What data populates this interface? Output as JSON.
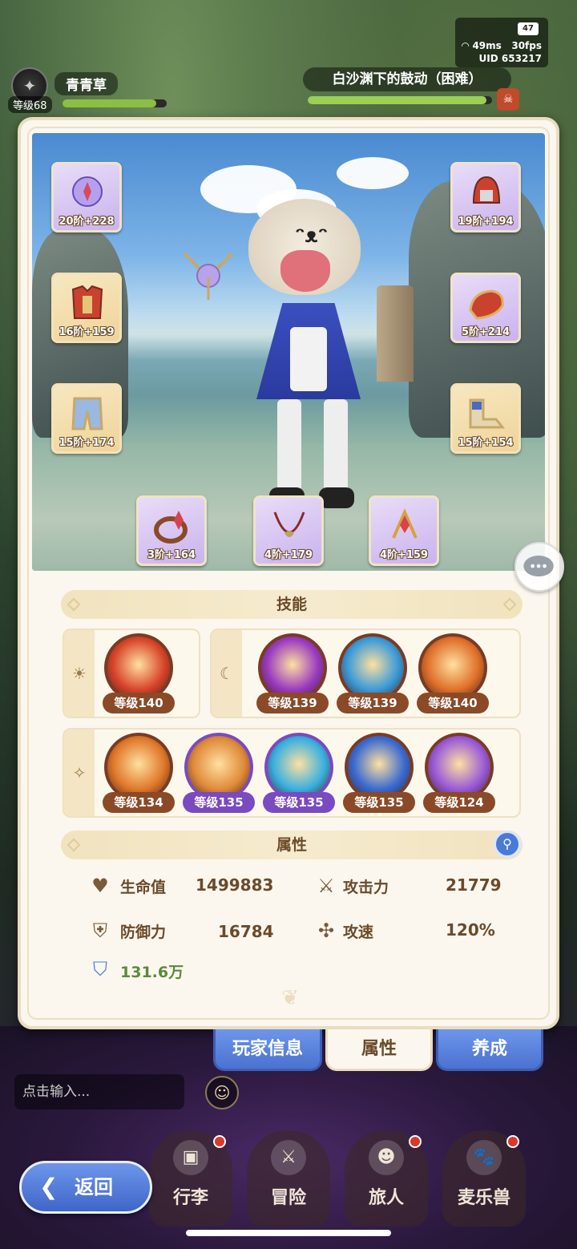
{
  "status": {
    "battery": "47",
    "ping": "49ms",
    "fps": "30fps",
    "uid": "UID 653217"
  },
  "player": {
    "name": "青青草",
    "level": "等级68",
    "exp_progress": 0.9
  },
  "quest": {
    "title": "白沙渊下的鼓动（困难）",
    "progress": 0.97
  },
  "equipment": [
    {
      "name": "staff-item",
      "label": "20阶+228",
      "rarity": "purple"
    },
    {
      "name": "armor-item",
      "label": "16阶+159",
      "rarity": "gold"
    },
    {
      "name": "pants-item",
      "label": "15阶+174",
      "rarity": "gold"
    },
    {
      "name": "helmet-item",
      "label": "19阶+194",
      "rarity": "purple"
    },
    {
      "name": "gloves-item",
      "label": "5阶+214",
      "rarity": "purple"
    },
    {
      "name": "boots-item",
      "label": "15阶+154",
      "rarity": "gold"
    },
    {
      "name": "bracelet-item",
      "label": "3阶+164",
      "rarity": "purple"
    },
    {
      "name": "necklace-item",
      "label": "4阶+179",
      "rarity": "purple"
    },
    {
      "name": "charm-item",
      "label": "4阶+159",
      "rarity": "purple"
    }
  ],
  "skills_section": {
    "title": "技能",
    "sun_group": [
      {
        "icon": "burst-star-icon",
        "level": "等级140",
        "color": "#d8442a",
        "purple": false
      }
    ],
    "moon_group": [
      {
        "icon": "crosshair-icon",
        "level": "等级139",
        "color": "#9a3ac0",
        "purple": false
      },
      {
        "icon": "shield-hands-icon",
        "level": "等级139",
        "color": "#3a9ad8",
        "purple": false
      },
      {
        "icon": "slash-icon",
        "level": "等级140",
        "color": "#e0702a",
        "purple": false
      }
    ],
    "star_group": [
      {
        "icon": "lightning-face-icon",
        "level": "等级134",
        "color": "#e0782a",
        "purple": false
      },
      {
        "icon": "thunder-icon",
        "level": "等级135",
        "color": "#e08a3a",
        "purple": true
      },
      {
        "icon": "electric-orb-icon",
        "level": "等级135",
        "color": "#3ab0e0",
        "purple": true
      },
      {
        "icon": "whirlwind-icon",
        "level": "等级135",
        "color": "#3a6ad0",
        "purple": false
      },
      {
        "icon": "purple-mist-icon",
        "level": "等级124",
        "color": "#9a5ad8",
        "purple": false
      }
    ]
  },
  "attributes_section": {
    "title": "属性",
    "hp_label": "生命值",
    "hp_value": "1499883",
    "atk_label": "攻击力",
    "atk_value": "21779",
    "def_label": "防御力",
    "def_value": "16784",
    "spd_label": "攻速",
    "spd_value": "120%",
    "power_value": "131.6万"
  },
  "tabs": {
    "player_info": "玩家信息",
    "attributes": "属性",
    "develop": "养成"
  },
  "chat": {
    "placeholder": "点击输入..."
  },
  "nav": {
    "bag": "行李",
    "adventure": "冒险",
    "traveler": "旅人",
    "pet": "麦乐兽"
  },
  "back_label": "返回",
  "colors": {
    "panel_bg": "#fbf7ee",
    "tab_blue": "#5a82dc",
    "text_brown": "#6b4a2a"
  }
}
